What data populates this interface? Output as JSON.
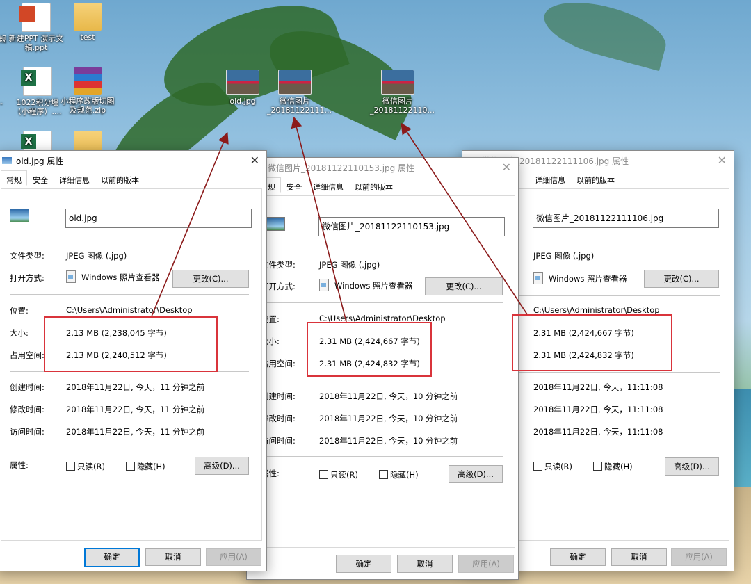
{
  "desktop_icons": [
    {
      "label": "新建PPT 演示文稿.ppt",
      "icon": "ppt-file-icon"
    },
    {
      "label": "test",
      "icon": "folder-icon"
    },
    {
      "label": "1022积分墙（小程序）....",
      "icon": "excel-file-icon"
    },
    {
      "label": "小程序改版切图及规范.zip",
      "icon": "zip-file-icon"
    },
    {
      "label": "old.jpg",
      "icon": "image-file-icon"
    },
    {
      "label": "微信图片_20181122111...",
      "icon": "image-file-icon"
    },
    {
      "label": "微信图片_20181122110...",
      "icon": "image-file-icon"
    },
    {
      "label": "规",
      "icon": "partial-label"
    },
    {
      "label": "-",
      "icon": "partial-label"
    }
  ],
  "dialog1": {
    "title": "old.jpg 属性",
    "tabs": [
      "常规",
      "安全",
      "详细信息",
      "以前的版本"
    ],
    "filename": "old.jpg",
    "labels": {
      "file_type": "文件类型:",
      "open_with": "打开方式:",
      "location": "位置:",
      "size": "大小:",
      "size_on_disk": "占用空间:",
      "created": "创建时间:",
      "modified": "修改时间:",
      "accessed": "访问时间:",
      "attributes": "属性:"
    },
    "file_type": "JPEG 图像 (.jpg)",
    "open_with": "Windows 照片查看器",
    "change_button": "更改(C)...",
    "location": "C:\\Users\\Administrator\\Desktop",
    "size": "2.13 MB (2,238,045 字节)",
    "size_on_disk": "2.13 MB (2,240,512 字节)",
    "created": "2018年11月22日, 今天，11 分钟之前",
    "modified": "2018年11月22日, 今天，11 分钟之前",
    "accessed": "2018年11月22日, 今天，11 分钟之前",
    "readonly": "只读(R)",
    "hidden": "隐藏(H)",
    "advanced_button": "高级(D)...",
    "ok": "确定",
    "cancel": "取消",
    "apply": "应用(A)"
  },
  "dialog2": {
    "title": "微信图片_20181122110153.jpg 属性",
    "tabs": [
      "规",
      "安全",
      "详细信息",
      "以前的版本"
    ],
    "filename": "微信图片_20181122110153.jpg",
    "labels": {
      "file_type": "文件类型:",
      "open_with": "打开方式:",
      "location": "位置:",
      "size": "大小:",
      "size_on_disk": "占用空间:",
      "created": "创建时间:",
      "modified": "修改时间:",
      "accessed": "访问时间:",
      "attributes": "属性:"
    },
    "file_type": "JPEG 图像 (.jpg)",
    "open_with": "Windows 照片查看器",
    "change_button": "更改(C)...",
    "location": "C:\\Users\\Administrator\\Desktop",
    "size": "2.31 MB (2,424,667 字节)",
    "size_on_disk": "2.31 MB (2,424,832 字节)",
    "created": "2018年11月22日, 今天，10 分钟之前",
    "modified": "2018年11月22日, 今天，10 分钟之前",
    "accessed": "2018年11月22日, 今天，10 分钟之前",
    "readonly": "只读(R)",
    "hidden": "隐藏(H)",
    "advanced_button": "高级(D)...",
    "ok": "确定",
    "cancel": "取消",
    "apply": "应用(A)"
  },
  "dialog3": {
    "title": "微信图片_20181122111106.jpg 属性",
    "tabs": [
      "详细信息",
      "以前的版本"
    ],
    "filename": "微信图片_20181122111106.jpg",
    "file_type": "JPEG 图像 (.jpg)",
    "open_with": "Windows 照片查看器",
    "change_button": "更改(C)...",
    "location": "C:\\Users\\Administrator\\Desktop",
    "size": "2.31 MB (2,424,667 字节)",
    "size_on_disk": "2.31 MB (2,424,832 字节)",
    "created": "2018年11月22日, 今天，11:11:08",
    "modified": "2018年11月22日, 今天，11:11:08",
    "accessed": "2018年11月22日, 今天，11:11:08",
    "readonly": "只读(R)",
    "hidden": "隐藏(H)",
    "advanced_button": "高级(D)...",
    "ok": "确定",
    "cancel": "取消",
    "apply": "应用(A)"
  },
  "colors": {
    "highlight_box": "#d9343b",
    "arrow": "#8b1a1a",
    "focus_border": "#0078d7"
  }
}
